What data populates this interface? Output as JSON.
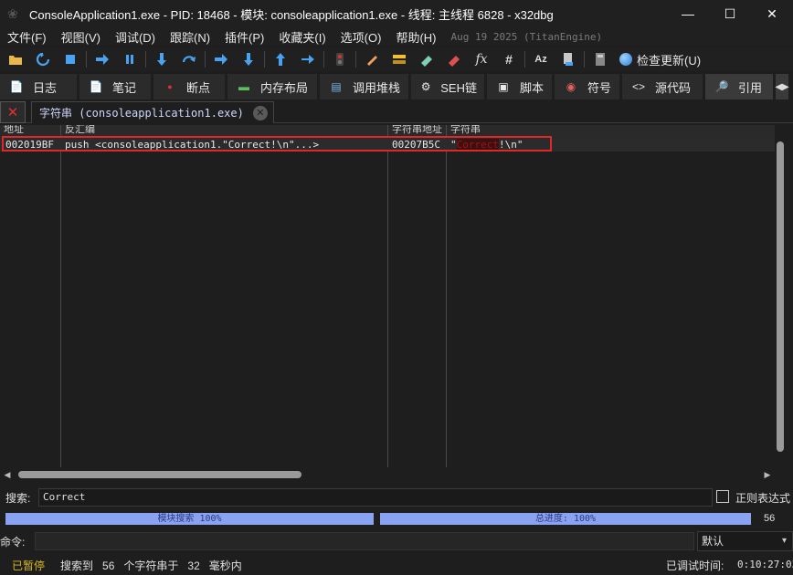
{
  "window": {
    "title": "ConsoleApplication1.exe - PID: 18468 - 模块: consoleapplication1.exe - 线程: 主线程 6828 - x32dbg",
    "minimize": "—",
    "maximize": "☐",
    "close": "✕"
  },
  "menu": {
    "items": [
      "文件(F)",
      "视图(V)",
      "调试(D)",
      "跟踪(N)",
      "插件(P)",
      "收藏夹(I)",
      "选项(O)",
      "帮助(H)"
    ],
    "date": "Aug 19 2025 (TitanEngine)"
  },
  "toolbar": {
    "icons": [
      "folder-open-icon",
      "restart-icon",
      "stop-icon",
      "run-icon",
      "pause-icon",
      "step-into-icon",
      "step-over-icon",
      "trace-into-icon",
      "trace-over-icon",
      "execute-till-return-icon",
      "run-to-user-code-icon",
      "bookmark-icon",
      "patch-icon",
      "comment-icon",
      "label-icon",
      "remove-icon",
      "function-icon",
      "hash-icon",
      "font-icon",
      "cpu-icon",
      "calculator-icon"
    ],
    "check_update": "检查更新(U)"
  },
  "tabs": [
    {
      "label": "日志",
      "icon": "log-icon"
    },
    {
      "label": "笔记",
      "icon": "notes-icon"
    },
    {
      "label": "断点",
      "icon": "breakpoint-icon"
    },
    {
      "label": "内存布局",
      "icon": "memory-map-icon"
    },
    {
      "label": "调用堆栈",
      "icon": "call-stack-icon"
    },
    {
      "label": "SEH链",
      "icon": "seh-icon"
    },
    {
      "label": "脚本",
      "icon": "script-icon"
    },
    {
      "label": "符号",
      "icon": "symbols-icon"
    },
    {
      "label": "源代码",
      "icon": "source-icon"
    },
    {
      "label": "引用",
      "icon": "references-icon"
    }
  ],
  "subtab": {
    "label": "字符串 (consoleapplication1.exe)"
  },
  "table": {
    "headers": [
      "地址",
      "反汇编",
      "字符串地址",
      "字符串"
    ],
    "rows": [
      {
        "address": "002019BF",
        "disasm": "push <consoleapplication1.\"Correct!\\n\"...>",
        "str_address": "00207B5C",
        "str_open": "\"",
        "str_hidden": "Correct",
        "str_close": "!\\n\""
      }
    ]
  },
  "search": {
    "label": "搜索:",
    "value": "Correct",
    "regex_label": "正则表达式"
  },
  "progress": {
    "module_search": "模块搜索 100%",
    "module_percent": 100,
    "total": "总进度: 100%",
    "total_percent": 100,
    "count": "56"
  },
  "command": {
    "label": "命令:",
    "default_option": "默认"
  },
  "status": {
    "state": "已暂停",
    "msg_found": "搜索到",
    "msg_count": "56",
    "msg_strings": "个字符串于",
    "msg_ms": "32",
    "msg_unit": "毫秒内",
    "time_label": "已调试时间:",
    "time_value": "0:10:27:03"
  },
  "colors": {
    "accent": "#8aa2f2",
    "highlight": "#e02828",
    "paused": "#d8b520"
  }
}
